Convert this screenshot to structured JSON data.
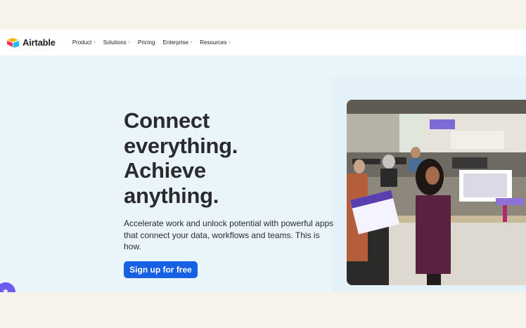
{
  "nav": {
    "logo_text": "Airtable",
    "items": [
      {
        "label": "Product",
        "has_chevron": true
      },
      {
        "label": "Solutions",
        "has_chevron": true
      },
      {
        "label": "Pricing",
        "has_chevron": false
      },
      {
        "label": "Enterprise",
        "has_chevron": true
      },
      {
        "label": "Resources",
        "has_chevron": true
      }
    ]
  },
  "hero": {
    "headline_lines": [
      "Connect",
      "everything.",
      "Achieve",
      "anything."
    ],
    "subcopy": "Accelerate work and unlock potential with powerful apps that connect your data, workflows and teams. This is how.",
    "cta_label": "Sign up for free",
    "image_icon": "office-photo"
  },
  "colors": {
    "brand_blue": "#1660e3",
    "hero_background": "#eaf4fb",
    "page_background": "#f6f4ea",
    "text_dark": "#2a2b2f"
  }
}
